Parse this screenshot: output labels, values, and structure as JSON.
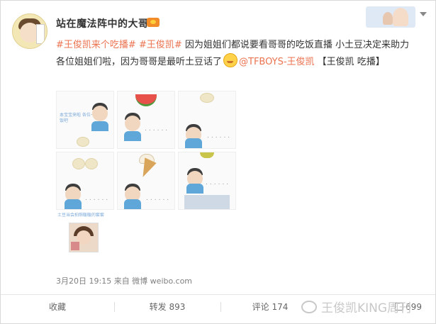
{
  "post": {
    "username": "站在魔法阵中的大哥",
    "text_parts": {
      "tag1": "#王俊凯来个吃播#",
      "tag2": "#王俊凯#",
      "body1": " 因为姐姐们都说要看哥哥的吃饭直播 小土豆决定来助力各位姐姐们啦，因为哥哥是最听土豆话了",
      "mention": "@TFBOYS-王俊凯",
      "link": " 【王俊凯 吃播】"
    },
    "meta": "3月20日 19:15 来自 微博 weibo.com"
  },
  "thumbs": {
    "t1_caption": "本宝宝来啦 各位一起吃个饭吧",
    "t9_caption": "土豆当会拍照暖暖的套套",
    "dots": "......"
  },
  "footer": {
    "favorite": "收藏",
    "repost": "转发 893",
    "comment": "评论 174",
    "like": "699",
    "watermark": "王俊凯KING周刊"
  },
  "colors": {
    "link": "#eb7350"
  }
}
